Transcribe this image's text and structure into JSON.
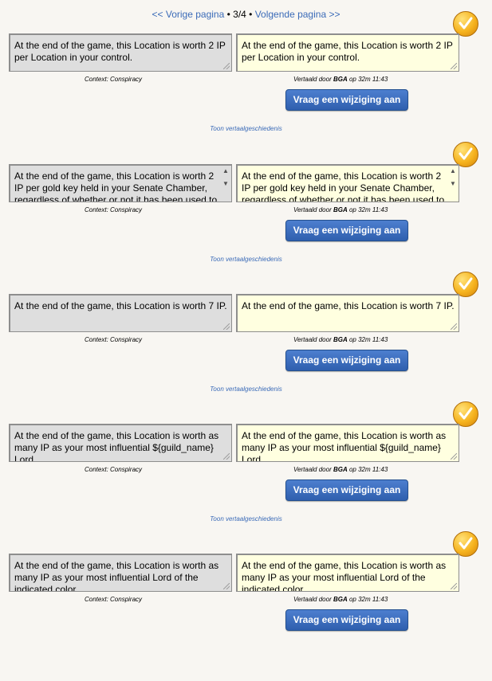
{
  "pager": {
    "prev_label": "<< Vorige pagina",
    "sep1": " • ",
    "current": "3/4",
    "sep2": " • ",
    "next_label": "Volgende pagina >>"
  },
  "button_label": "Vraag een wijziging aan",
  "history_label": "Toon vertaalgeschiedenis",
  "entries": [
    {
      "original": "At the end of the game, this Location is worth 2 IP per Location in your control.",
      "translation": "At the end of the game, this Location is worth 2 IP per Location in your control.",
      "context": "Context: Conspiracy",
      "translated_by_prefix": "Vertaald door ",
      "translated_by_user": "BGA",
      "translated_by_suffix": " op 32m 11:43"
    },
    {
      "original": "At the end of the game, this Location is worth 2 IP per gold key held in your Senate Chamber, regardless of whether or not it has been used to",
      "translation": "At the end of the game, this Location is worth 2 IP per gold key held in your Senate Chamber, regardless of whether or not it has been used to",
      "context": "Context: Conspiracy",
      "translated_by_prefix": "Vertaald door ",
      "translated_by_user": "BGA",
      "translated_by_suffix": " op 32m 11:43"
    },
    {
      "original": "At the end of the game, this Location is worth 7 IP.",
      "translation": "At the end of the game, this Location is worth 7 IP.",
      "context": "Context: Conspiracy",
      "translated_by_prefix": "Vertaald door ",
      "translated_by_user": "BGA",
      "translated_by_suffix": " op 32m 11:43"
    },
    {
      "original": "At the end of the game, this Location is worth as many IP as your most influential ${guild_name} Lord.",
      "translation": "At the end of the game, this Location is worth as many IP as your most influential ${guild_name} Lord.",
      "context": "Context: Conspiracy",
      "translated_by_prefix": "Vertaald door ",
      "translated_by_user": "BGA",
      "translated_by_suffix": " op 32m 11:43"
    },
    {
      "original": "At the end of the game, this Location is worth as many IP as your most influential Lord of the indicated color.",
      "translation": "At the end of the game, this Location is worth as many IP as your most influential Lord of the indicated color.",
      "context": "Context: Conspiracy",
      "translated_by_prefix": "Vertaald door ",
      "translated_by_user": "BGA",
      "translated_by_suffix": " op 32m 11:43"
    }
  ],
  "colors": {
    "background": "#f8f6f2",
    "link": "#3b6bb8",
    "button": "#3a6ab9",
    "original_box": "#dedede",
    "translation_box": "#ffffe0",
    "check_badge": "#f6b31e"
  },
  "icons": [
    "check-badge-icon",
    "resize-grip-icon",
    "scroll-up-icon",
    "scroll-down-icon"
  ]
}
